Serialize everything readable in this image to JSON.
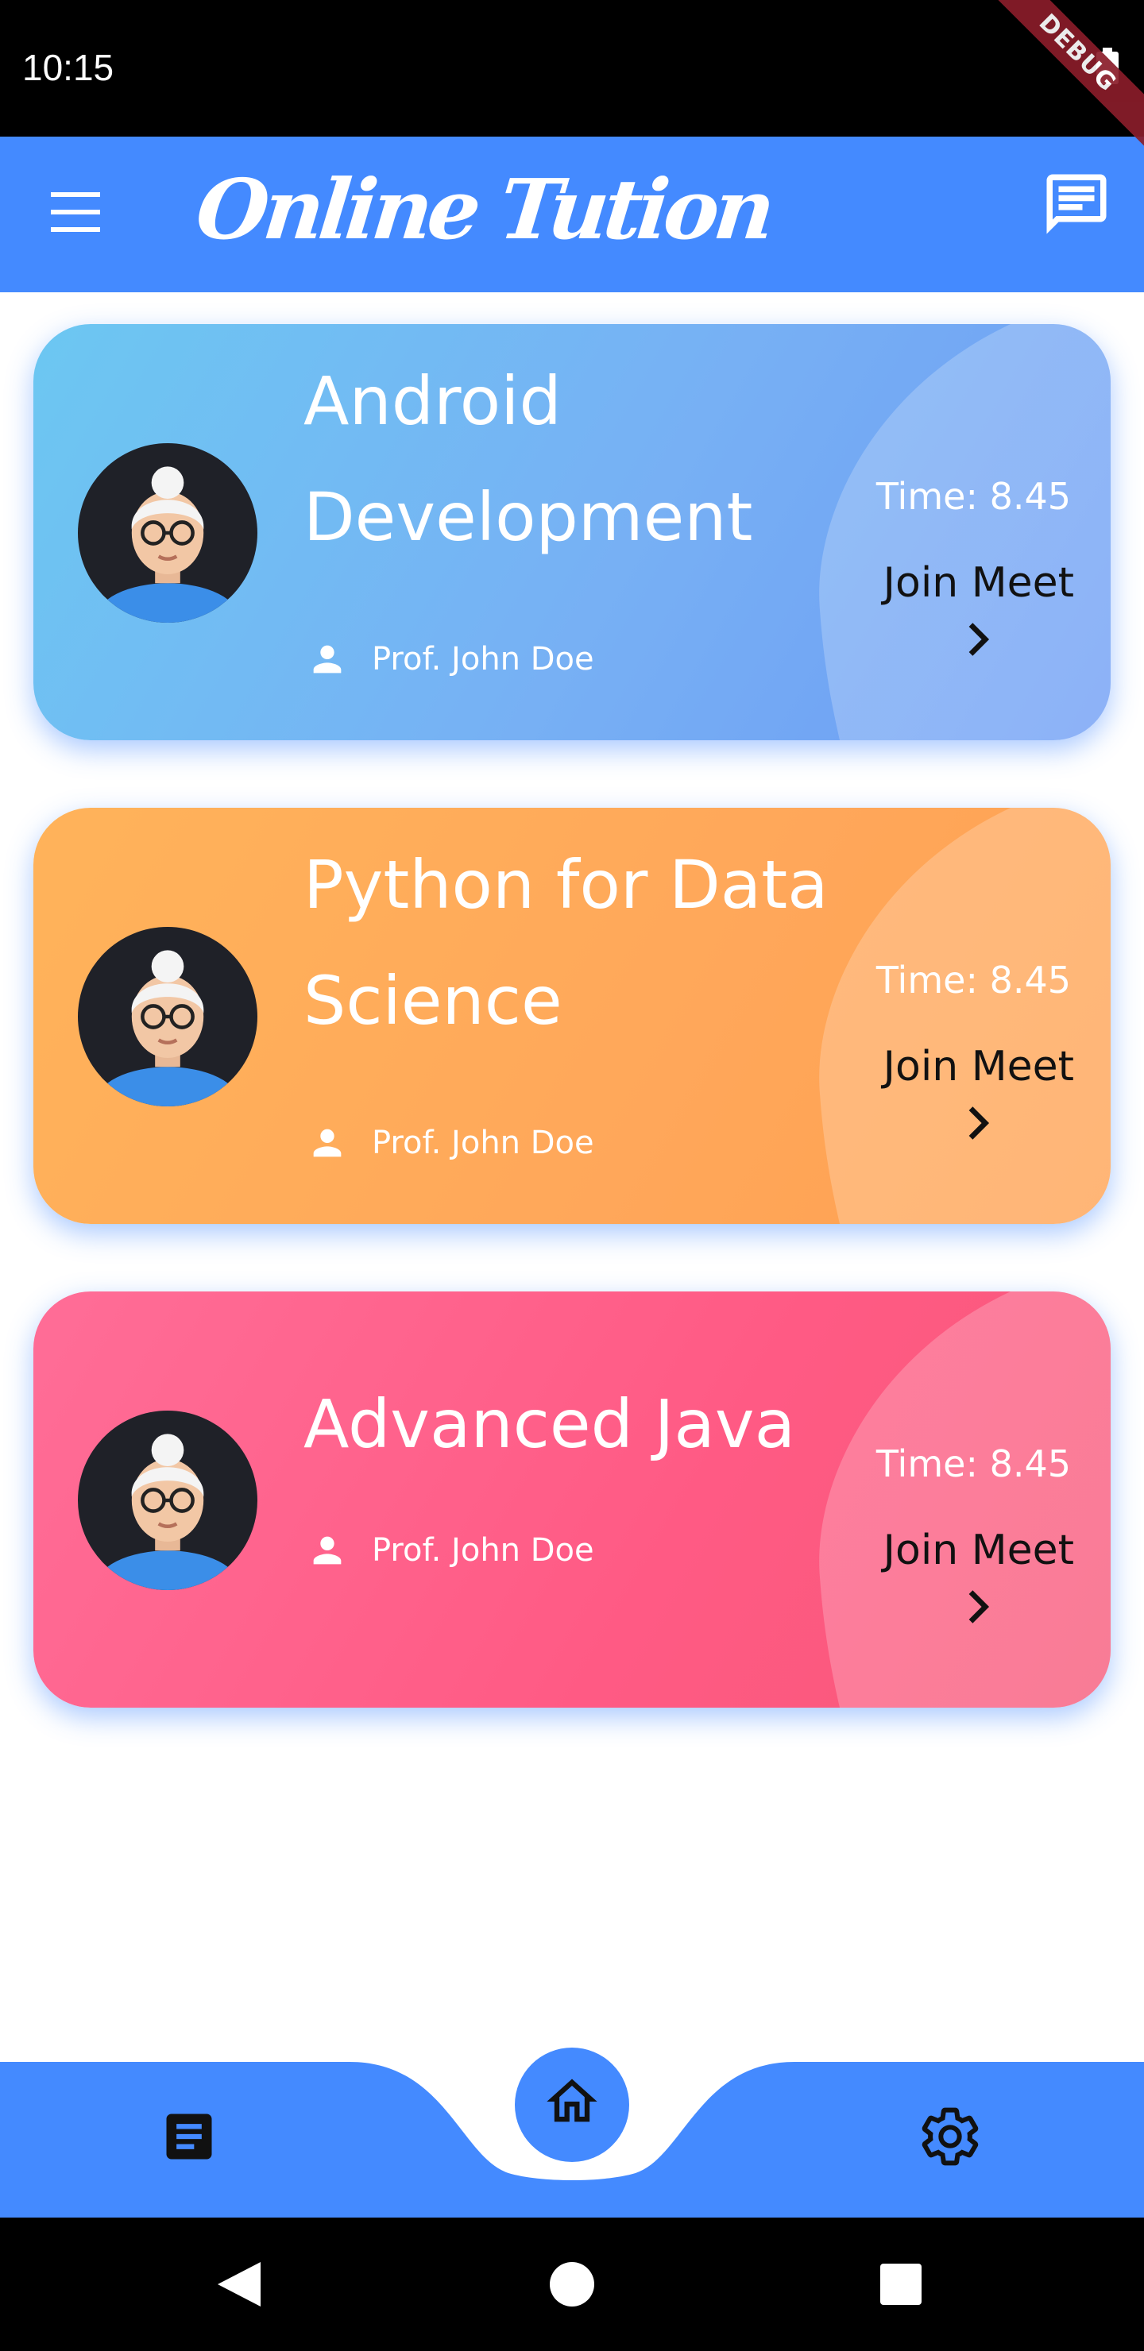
{
  "status_bar": {
    "time": "10:15",
    "debug_label": "DEBUG"
  },
  "app_bar": {
    "title": "Online Tution",
    "menu_icon": "menu-icon",
    "chat_icon": "chat-icon"
  },
  "classes": [
    {
      "title_line1": "Android",
      "title_line2": "Development",
      "instructor": "Prof. John Doe",
      "time": "Time: 8.45",
      "join_label": "Join Meet",
      "color": "#77b0f4"
    },
    {
      "title_line1": "Python for Data",
      "title_line2": "Science",
      "instructor": "Prof. John Doe",
      "time": "Time: 8.45",
      "join_label": "Join Meet",
      "color": "#ffa75a"
    },
    {
      "title_line1": "Advanced Java",
      "instructor": "Prof. John Doe",
      "time": "Time: 8.45",
      "join_label": "Join Meet",
      "color": "#ff5a84"
    }
  ],
  "bottom_nav": {
    "items": [
      "docs-icon",
      "home-icon",
      "settings-icon"
    ],
    "active": "home-icon",
    "accent": "#448aff"
  },
  "system_nav": {
    "items": [
      "back-icon",
      "home-circle-icon",
      "recents-icon"
    ]
  }
}
